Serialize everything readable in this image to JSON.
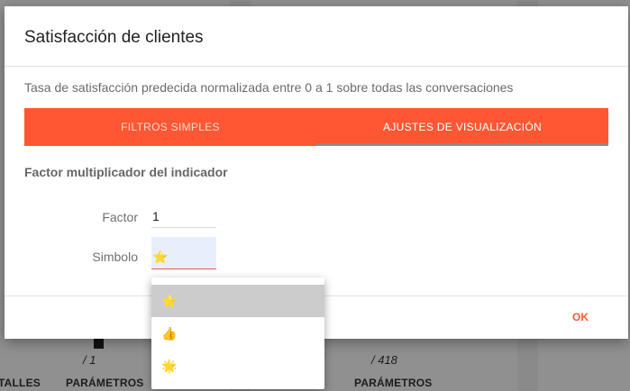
{
  "background": {
    "labels_bottom": [
      "TALLES",
      "PARÁMETROS",
      "PARÁMETROS"
    ],
    "values_bottom": [
      "/ 1",
      "/ 418"
    ]
  },
  "dialog": {
    "title": "Satisfacción de clientes",
    "subtitle": "Tasa de satisfacción predecida normalizada entre 0 a 1 sobre todas las conversaciones",
    "tabs": [
      {
        "label": "FILTROS SIMPLES",
        "active": false
      },
      {
        "label": "AJUSTES DE VISUALIZACIÓN",
        "active": true
      }
    ],
    "section_title": "Factor multiplicador del indicador",
    "factor": {
      "label": "Factor",
      "value": "1"
    },
    "simbolo": {
      "label": "Simbolo",
      "value": "⭐"
    },
    "ok_label": "OK"
  },
  "dropdown": {
    "options": [
      "⭐",
      "👍",
      "🌟"
    ],
    "selected_index": 0
  },
  "colors": {
    "accent": "#ff5733",
    "select_bg": "#e8effc",
    "selected_option_bg": "#cccccc"
  }
}
